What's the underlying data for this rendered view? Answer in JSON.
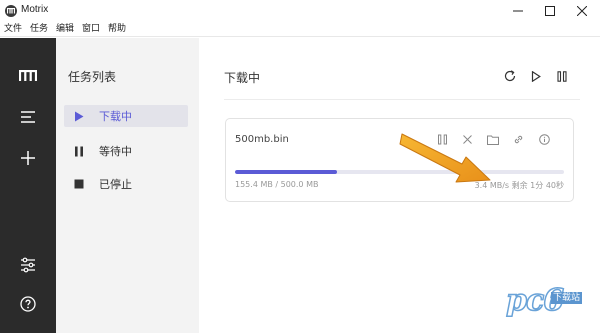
{
  "window": {
    "title": "Motrix",
    "minimize_icon": "minimize-icon",
    "maximize_icon": "maximize-icon",
    "close_icon": "close-icon"
  },
  "menubar": {
    "items": [
      "文件",
      "任务",
      "编辑",
      "窗口",
      "帮助"
    ]
  },
  "sidebar": {
    "icons": [
      "motrix-logo-icon",
      "task-list-icon",
      "add-task-icon",
      "settings-icon",
      "help-icon"
    ]
  },
  "tasklist": {
    "title": "任务列表",
    "items": [
      {
        "label": "下载中",
        "icon": "play-icon",
        "active": true
      },
      {
        "label": "等待中",
        "icon": "pause-icon",
        "active": false
      },
      {
        "label": "已停止",
        "icon": "stop-icon",
        "active": false
      }
    ]
  },
  "main": {
    "title": "下载中",
    "header_icons": [
      "refresh-icon",
      "resume-all-icon",
      "pause-all-icon"
    ]
  },
  "task": {
    "name": "500mb.bin",
    "downloaded": "155.4 MB / 500.0 MB",
    "progress": 0.311,
    "speed_remaining": "3.4 MB/s 剩余 1分 40秒",
    "actions": [
      "pause-icon",
      "delete-icon",
      "folder-icon",
      "link-icon",
      "info-icon"
    ]
  },
  "watermark": {
    "brand": "pc6",
    "tag": "下载站"
  },
  "colors": {
    "accent": "#5b5bd6",
    "sidebar_bg": "#2b2b2b",
    "annotation_arrow": "#f0a020"
  }
}
